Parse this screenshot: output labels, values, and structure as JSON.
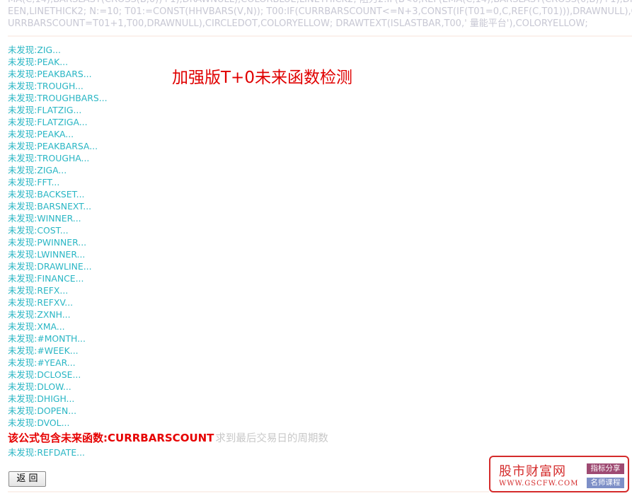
{
  "code_lines": [
    "MA(C,14),BARSLAST(CROSS(B,0))+1),DRAWNULL),COLORBLUE,LINETHICK2; 阻力2:IF(B<0,REF(EMA(C,14),BARSLAST(CROSS(0,B))+1),DRAWNULL),COLORGR",
    "EEN,LINETHICK2; N:=10; T01:=CONST(HHVBARS(V,N)); T00:IF(CURRBARSCOUNT<=N+3,CONST(IF(T01=0,C,REF(C,T01))),DRAWNULL),COLORYELLOW,LINETHICK2; DRAWICON(C",
    "URRBARSCOUNT=T01+1,T00,DRAWNULL),CIRCLEDOT,COLORYELLOW; DRAWTEXT(ISLASTBAR,T00,' 量能平台'),COLORYELLOW;"
  ],
  "title": "加强版T+0未来函数检测",
  "results": [
    "未发现:ZIG...",
    "未发现:PEAK...",
    "未发现:PEAKBARS...",
    "未发现:TROUGH...",
    "未发现:TROUGHBARS...",
    "未发现:FLATZIG...",
    "未发现:FLATZIGA...",
    "未发现:PEAKA...",
    "未发现:PEAKBARSA...",
    "未发现:TROUGHA...",
    "未发现:ZIGA...",
    "未发现:FFT...",
    "未发现:BACKSET...",
    "未发现:BARSNEXT...",
    "未发现:WINNER...",
    "未发现:COST...",
    "未发现:PWINNER...",
    "未发现:LWINNER...",
    "未发现:DRAWLINE...",
    "未发现:FINANCE...",
    "未发现:REFX...",
    "未发现:REFXV...",
    "未发现:ZXNH...",
    "未发现:XMA...",
    "未发现:#MONTH...",
    "未发现:#WEEK...",
    "未发现:#YEAR...",
    "未发现:DCLOSE...",
    "未发现:DLOW...",
    "未发现:DHIGH...",
    "未发现:DOPEN...",
    "未发现:DVOL..."
  ],
  "warning": {
    "text": "该公式包含未来函数:CURRBARSCOUNT",
    "desc": "求到最后交易日的周期数"
  },
  "last_result": "未发现:REFDATE...",
  "return_button": "返 回",
  "logo": {
    "name": "股市财富网",
    "url": "WWW.GSCFW.COM",
    "tag1": "指标分享",
    "tag2": "名师课程"
  },
  "colors": {
    "result": "#29b6c4",
    "warning": "#e60000",
    "title": "#e00000",
    "code": "#c8c8d4",
    "logo": "#d42b2b"
  }
}
